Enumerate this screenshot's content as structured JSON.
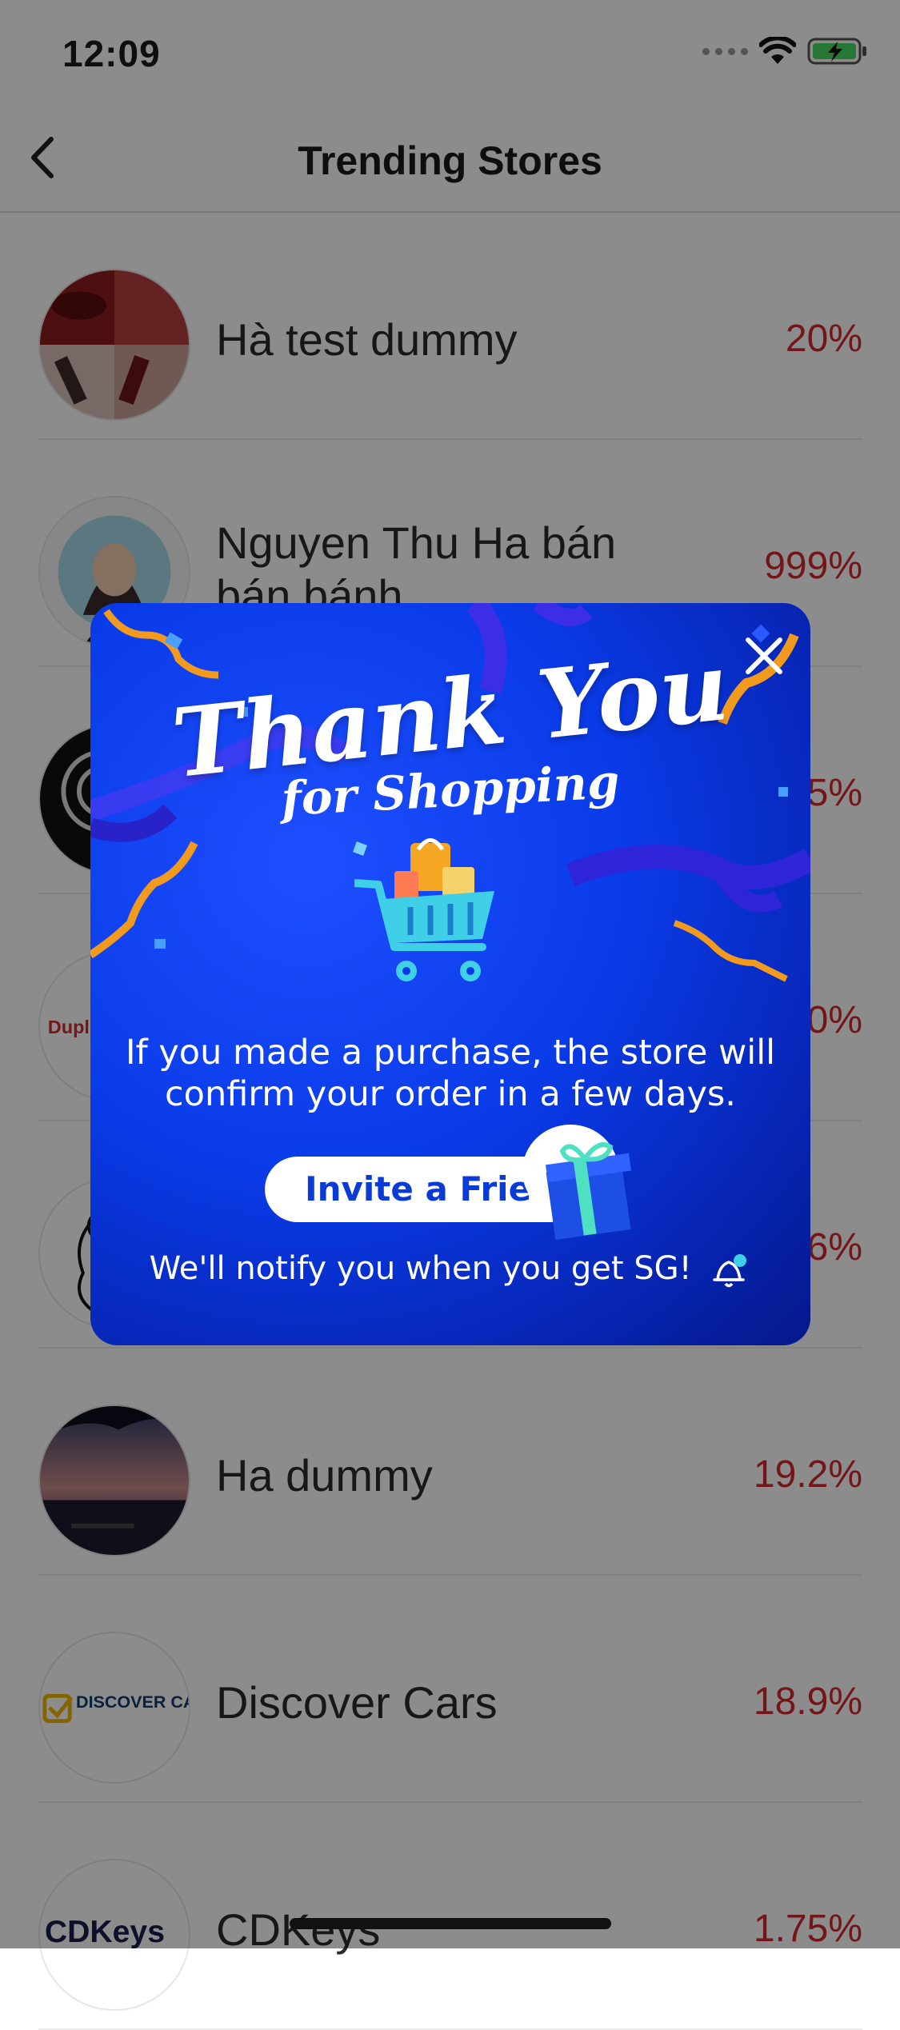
{
  "status_bar": {
    "time": "12:09"
  },
  "nav": {
    "title": "Trending Stores"
  },
  "stores": [
    {
      "name": "Hà test dummy",
      "percent": "20%"
    },
    {
      "name": "Nguyen Thu Ha bán bán bánh",
      "percent": "999%"
    },
    {
      "name": "",
      "percent": "5%"
    },
    {
      "name": "",
      "percent": "0%",
      "avatar_text": "Dupli"
    },
    {
      "name": "",
      "percent": "6%"
    },
    {
      "name": "Ha dummy",
      "percent": "19.2%"
    },
    {
      "name": "Discover Cars",
      "percent": "18.9%",
      "avatar_text": "DISCOVER CARS"
    },
    {
      "name": "CDKeys",
      "percent": "1.75%",
      "avatar_text": "CDKeys"
    }
  ],
  "modal": {
    "title_line1": "Thank You",
    "title_line2": "for Shopping",
    "message": "If you made a purchase, the store will confirm your order in a few days.",
    "invite_label": "Invite a Friend",
    "notify_text": "We'll notify you when you get SG!"
  },
  "colors": {
    "accent_red": "#d2292f",
    "modal_blue": "#0a3be8",
    "invite_text": "#0b3bd6"
  },
  "icons": [
    "back-chevron-icon",
    "wifi-icon",
    "battery-icon",
    "close-icon",
    "shopping-cart-icon",
    "gift-icon",
    "bell-icon"
  ]
}
